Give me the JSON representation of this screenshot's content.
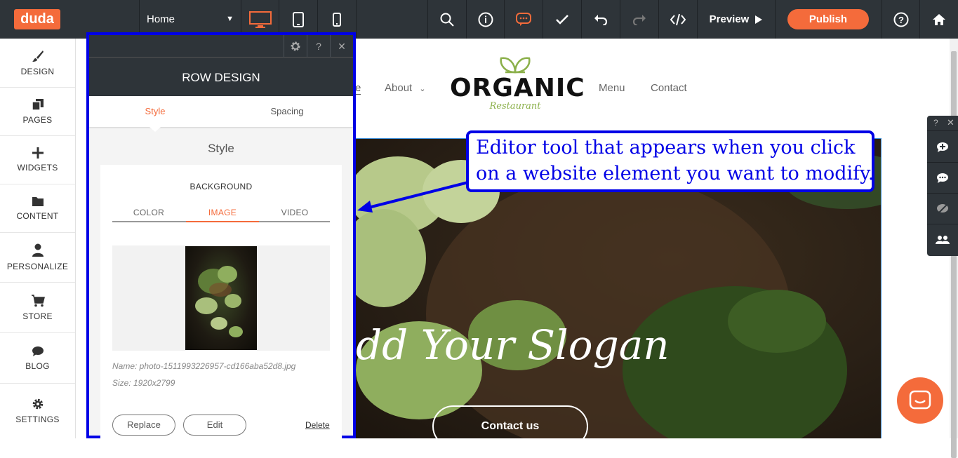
{
  "brand": {
    "logo_text": "duda",
    "accent": "#f46b3b",
    "callout_color": "#0000e6"
  },
  "toolbar": {
    "page_select": "Home",
    "devices": [
      "desktop-icon",
      "tablet-icon",
      "mobile-icon"
    ],
    "actions": [
      "search-icon",
      "info-icon",
      "comment-icon",
      "check-icon",
      "undo-icon",
      "redo-icon",
      "code-icon"
    ],
    "preview_label": "Preview",
    "publish_label": "Publish"
  },
  "sidebar": {
    "items": [
      {
        "label": "DESIGN",
        "icon": "brush-icon"
      },
      {
        "label": "PAGES",
        "icon": "pages-icon"
      },
      {
        "label": "WIDGETS",
        "icon": "plus-icon"
      },
      {
        "label": "CONTENT",
        "icon": "folder-icon"
      },
      {
        "label": "PERSONALIZE",
        "icon": "person-icon"
      },
      {
        "label": "STORE",
        "icon": "cart-icon"
      },
      {
        "label": "BLOG",
        "icon": "chat-icon"
      },
      {
        "label": "SETTINGS",
        "icon": "gear-icon"
      }
    ]
  },
  "site": {
    "nav": {
      "partial_home": "e",
      "about": "About",
      "menu": "Menu",
      "contact": "Contact"
    },
    "logo_title": "ORGANIC",
    "logo_sub": "Restaurant",
    "slogan": "dd Your Slogan",
    "cta": "Contact us"
  },
  "panel": {
    "title": "ROW DESIGN",
    "tabs": [
      "Style",
      "Spacing"
    ],
    "heading": "Style",
    "background_label": "BACKGROUND",
    "subtabs": [
      "COLOR",
      "IMAGE",
      "VIDEO"
    ],
    "file_name": "Name: photo-1511993226957-cd166aba52d8.jpg",
    "file_size": "Size: 1920x2799",
    "replace_label": "Replace",
    "edit_label": "Edit",
    "delete_label": "Delete"
  },
  "callout": {
    "line1": "Editor tool that appears when you click",
    "line2": "on a website element you want to modify."
  }
}
